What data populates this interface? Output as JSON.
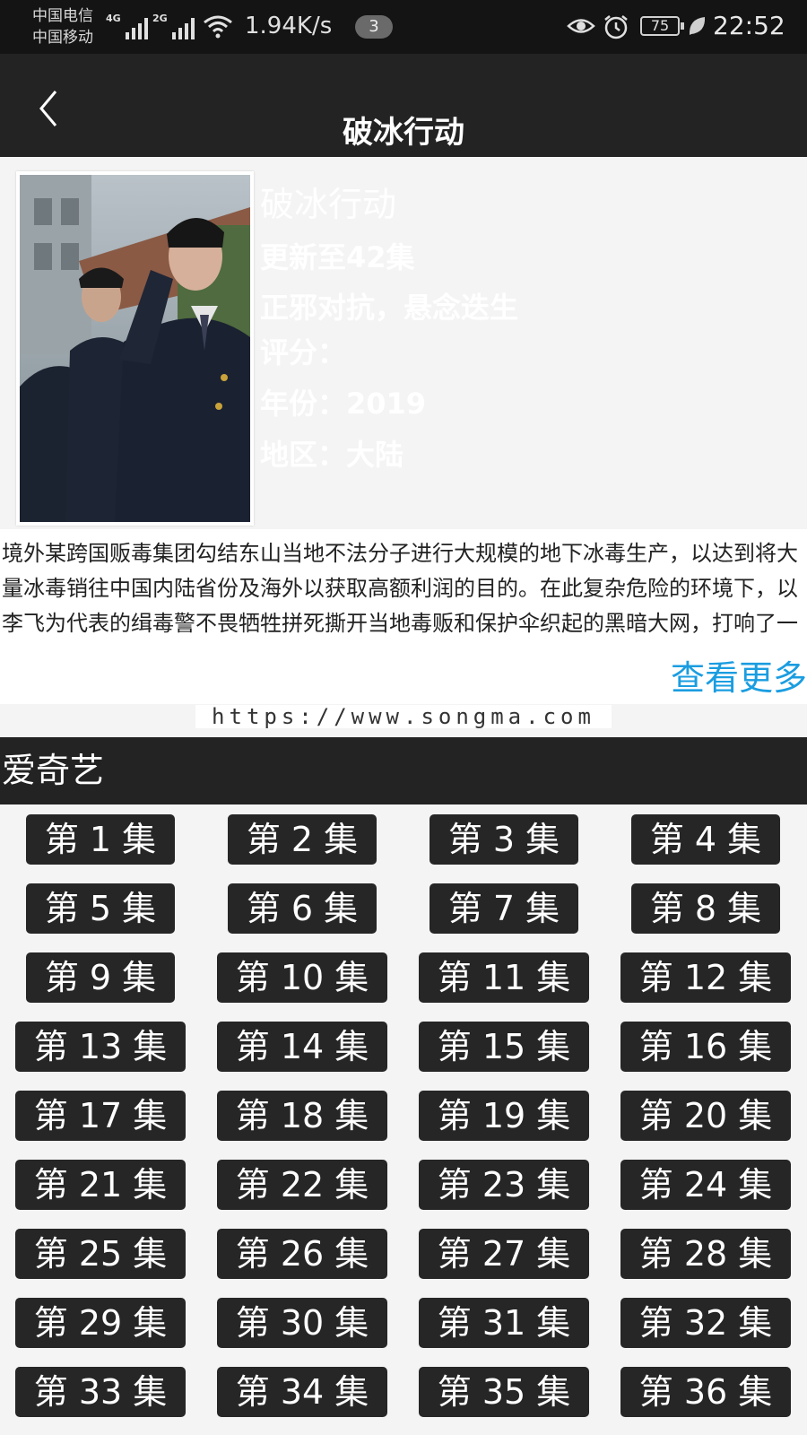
{
  "status": {
    "carrier1": "中国电信",
    "carrier2": "中国移动",
    "net1": "4G",
    "net2": "2G",
    "speed": "1.94K/s",
    "notif_count": "3",
    "battery": "75",
    "time": "22:52"
  },
  "header": {
    "title": "破冰行动"
  },
  "info": {
    "name": "破冰行动",
    "update": "更新至42集",
    "tagline": "正邪对抗，悬念迭生",
    "rating": "评分：",
    "year": "年份：2019",
    "region": "地区：大陆"
  },
  "description": "境外某跨国贩毒集团勾结东山当地不法分子进行大规模的地下冰毒生产，以达到将大量冰毒销往中国内陆省份及海外以获取高额利润的目的。在此复杂危险的环境下，以李飞为代表的缉毒警不畏牺牲拼死撕开当地毒贩和保护伞织起的黑暗大网，打响了一场惊心动魄的缉毒攻坚战。",
  "more_label": "查看更多",
  "watermark": "https://www.songma.com",
  "source": "爱奇艺",
  "episodes": [
    "第 1 集",
    "第 2 集",
    "第 3 集",
    "第 4 集",
    "第 5 集",
    "第 6 集",
    "第 7 集",
    "第 8 集",
    "第 9 集",
    "第 10 集",
    "第 11 集",
    "第 12 集",
    "第 13 集",
    "第 14 集",
    "第 15 集",
    "第 16 集",
    "第 17 集",
    "第 18 集",
    "第 19 集",
    "第 20 集",
    "第 21 集",
    "第 22 集",
    "第 23 集",
    "第 24 集",
    "第 25 集",
    "第 26 集",
    "第 27 集",
    "第 28 集",
    "第 29 集",
    "第 30 集",
    "第 31 集",
    "第 32 集",
    "第 33 集",
    "第 34 集",
    "第 35 集",
    "第 36 集"
  ]
}
